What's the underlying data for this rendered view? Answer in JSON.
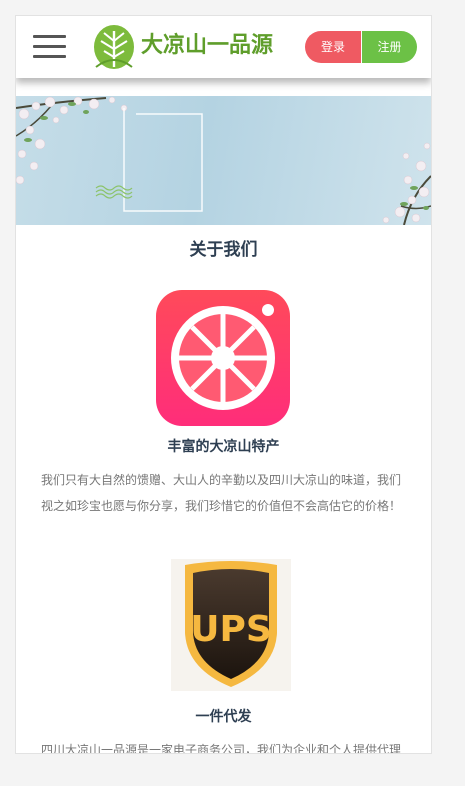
{
  "header": {
    "menu_icon": "hamburger-icon",
    "logo_text": "大凉山一品源",
    "login_label": "登录",
    "register_label": "注册",
    "colors": {
      "login": "#ef5a62",
      "register": "#6cc146",
      "logo": "#5f9e2b"
    }
  },
  "about": {
    "title": "关于我们",
    "features": [
      {
        "icon": "grapefruit-app-icon",
        "title": "丰富的大凉山特产",
        "desc": "我们只有大自然的馈赠、大山人的辛勤以及四川大凉山的味道，我们视之如珍宝也愿与你分享，我们珍惜它的价值但不会高估它的价格！"
      },
      {
        "icon": "ups-shield-icon",
        "title": "一件代发",
        "desc": "四川大凉山一品源是一家电子商务公司，我们为企业和个人提供代理"
      }
    ]
  }
}
